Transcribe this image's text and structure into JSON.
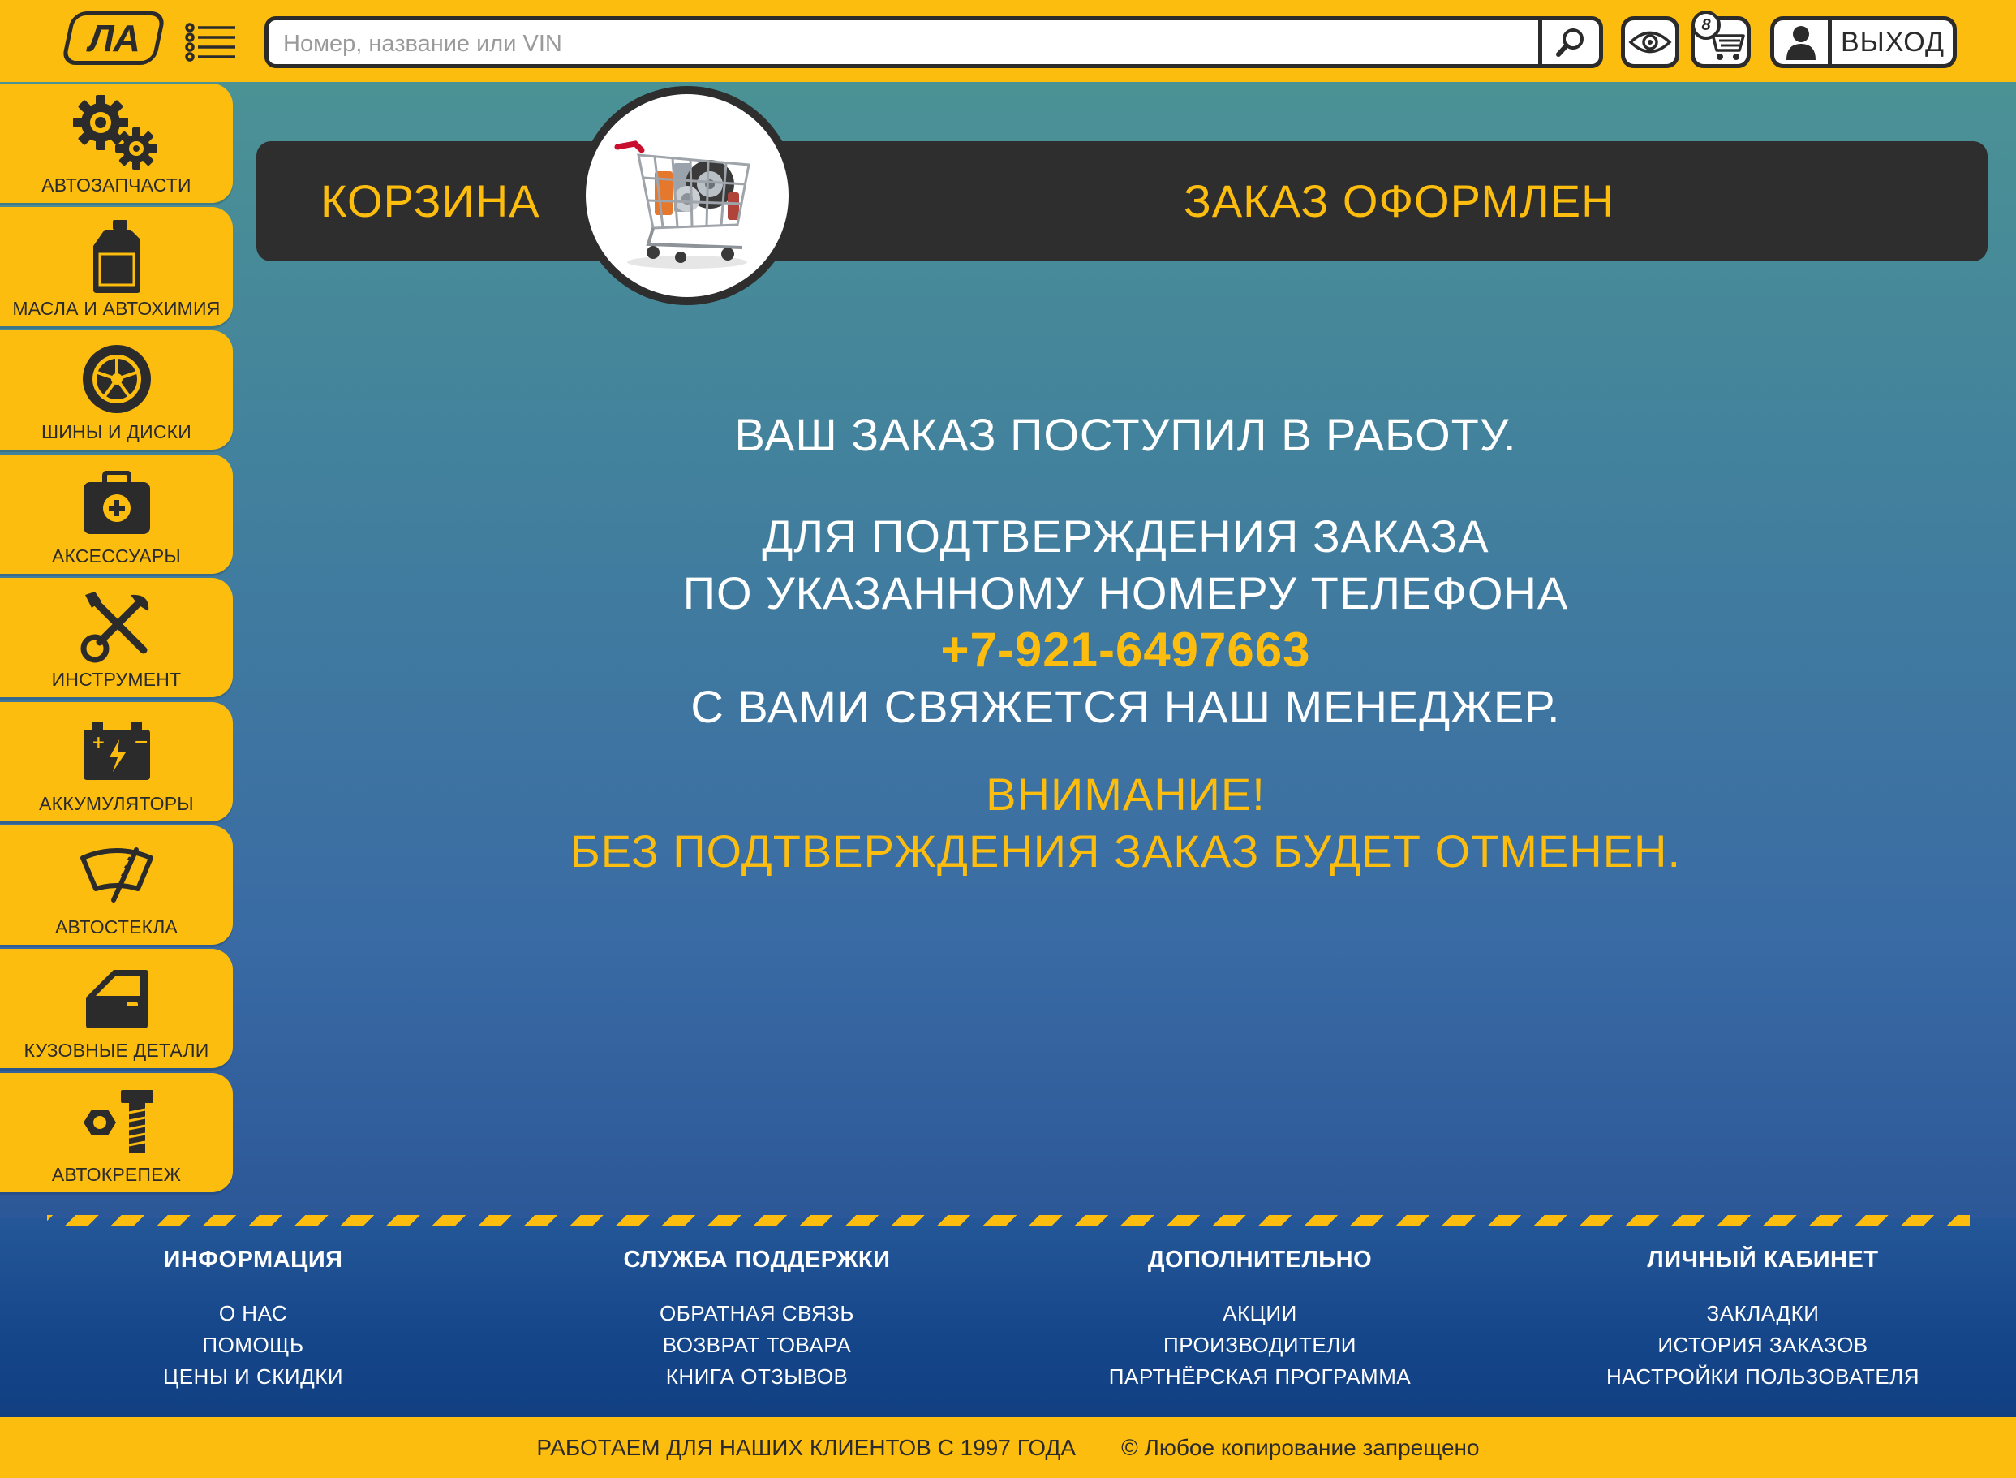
{
  "header": {
    "logo_text": "ЛА",
    "search_placeholder": "Номер, название или VIN",
    "cart_count": "8",
    "logout_label": "ВЫХОД"
  },
  "categories": [
    {
      "label": "АВТОЗАПЧАСТИ",
      "icon": "gears-icon"
    },
    {
      "label": "МАСЛА И АВТОХИМИЯ",
      "icon": "oil-canister-icon"
    },
    {
      "label": "ШИНЫ И ДИСКИ",
      "icon": "wheel-icon"
    },
    {
      "label": "АКСЕССУАРЫ",
      "icon": "first-aid-kit-icon"
    },
    {
      "label": "ИНСТРУМЕНТ",
      "icon": "tools-icon"
    },
    {
      "label": "АККУМУЛЯТОРЫ",
      "icon": "battery-icon"
    },
    {
      "label": "АВТОСТЕКЛА",
      "icon": "windshield-icon"
    },
    {
      "label": "КУЗОВНЫЕ ДЕТАЛИ",
      "icon": "car-door-icon"
    },
    {
      "label": "АВТОКРЕПЕЖ",
      "icon": "bolt-nut-icon"
    }
  ],
  "banner": {
    "left_title": "КОРЗИНА",
    "right_title": "ЗАКАЗ ОФОРМЛЕН"
  },
  "message": {
    "line1": "ВАШ ЗАКАЗ ПОСТУПИЛ В РАБОТУ.",
    "line2": "ДЛЯ ПОДТВЕРЖДЕНИЯ ЗАКАЗА",
    "line3": "ПО УКАЗАННОМУ НОМЕРУ ТЕЛЕФОНА",
    "phone": "+7-921-6497663",
    "line4": "С ВАМИ СВЯЖЕТСЯ НАШ МЕНЕДЖЕР.",
    "warning_title": "ВНИМАНИЕ!",
    "warning_text": "БЕЗ ПОДТВЕРЖДЕНИЯ ЗАКАЗ БУДЕТ ОТМЕНЕН."
  },
  "footer": {
    "columns": [
      {
        "title": "ИНФОРМАЦИЯ",
        "links": [
          "О НАС",
          "ПОМОЩЬ",
          "ЦЕНЫ И СКИДКИ"
        ]
      },
      {
        "title": "СЛУЖБА ПОДДЕРЖКИ",
        "links": [
          "ОБРАТНАЯ СВЯЗЬ",
          "ВОЗВРАТ ТОВАРА",
          "КНИГА ОТЗЫВОВ"
        ]
      },
      {
        "title": "ДОПОЛНИТЕЛЬНО",
        "links": [
          "АКЦИИ",
          "ПРОИЗВОДИТЕЛИ",
          "ПАРТНЁРСКАЯ ПРОГРАММА"
        ]
      },
      {
        "title": "ЛИЧНЫЙ КАБИНЕТ",
        "links": [
          "ЗАКЛАДКИ",
          "ИСТОРИЯ ЗАКАЗОВ",
          "НАСТРОЙКИ ПОЛЬЗОВАТЕЛЯ"
        ]
      }
    ],
    "since_text": "РАБОТАЕМ ДЛЯ НАШИХ КЛИЕНТОВ С 1997 ГОДА",
    "copyright_text": "©  Любое копирование запрещено"
  },
  "colors": {
    "accent": "#FDBD0E",
    "dark": "#2E2E2E",
    "main_gradient_top": "#4B9295",
    "main_gradient_bottom": "#2C5798",
    "footer_blue": "#1A4C8E"
  }
}
